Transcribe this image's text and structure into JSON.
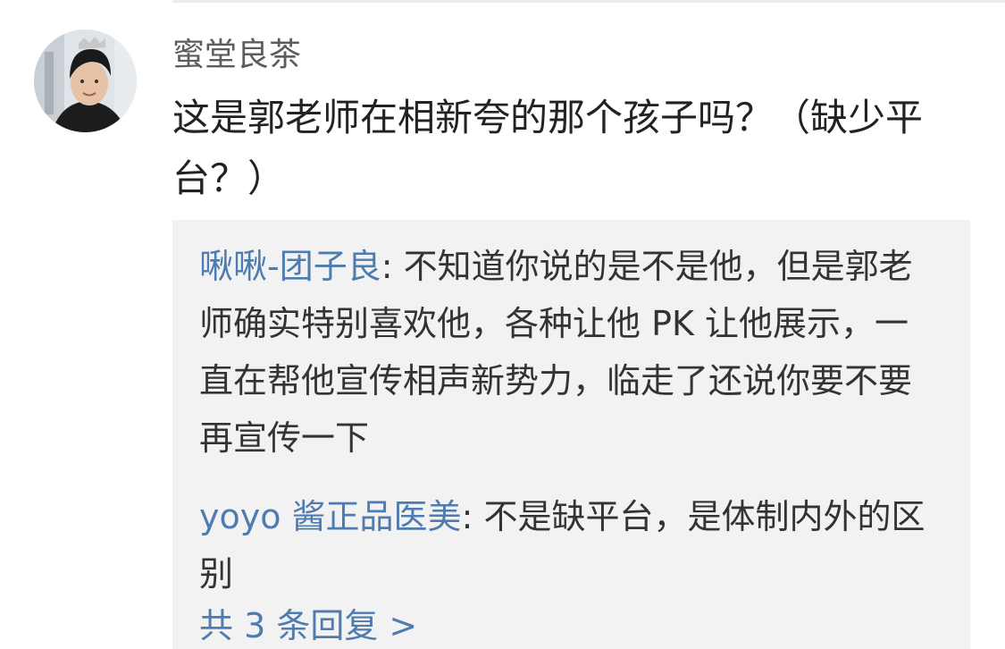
{
  "comment": {
    "avatar_icon": "user-avatar-photo",
    "username": "蜜堂良茶",
    "text": "这是郭老师在相新夸的那个孩子吗？（缺少平台？）"
  },
  "replies": [
    {
      "author": "啾啾-团子良",
      "separator": ": ",
      "text": "不知道你说的是不是他，但是郭老师确实特别喜欢他，各种让他 PK 让他展示，一直在帮他宣传相声新势力，临走了还说你要不要再宣传一下"
    },
    {
      "author": "yoyo 酱正品医美",
      "separator": ": ",
      "text": "不是缺平台，是体制内外的区别"
    }
  ],
  "more_replies_label": "共 3 条回复 >",
  "colors": {
    "link_blue": "#4e7bb0",
    "reply_bg": "#f2f2f2",
    "username_gray": "#5c5c5c",
    "text_dark": "#222222"
  }
}
